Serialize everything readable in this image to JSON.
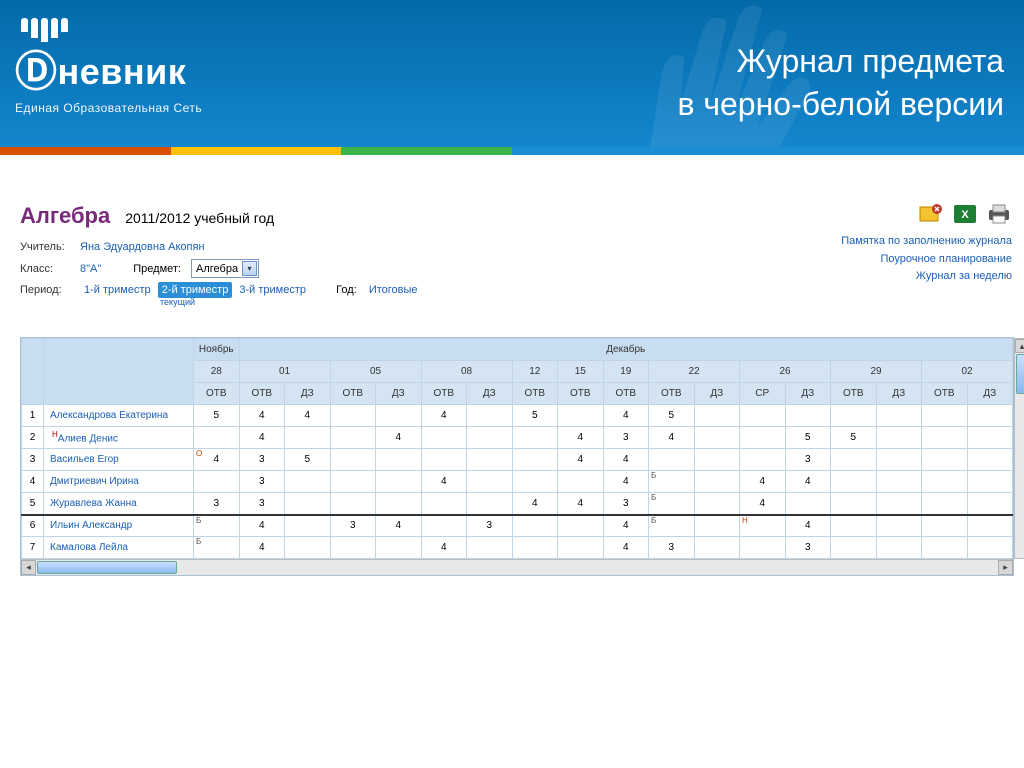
{
  "banner": {
    "logo_name": "невник",
    "logo_subtitle": "Единая Образовательная Сеть",
    "title_line1": "Журнал предмета",
    "title_line2": "в черно-белой версии"
  },
  "subject": {
    "title": "Алгебра",
    "year": "2011/2012 учебный год"
  },
  "meta": {
    "teacher_label": "Учитель:",
    "teacher_name": "Яна Эдуардовна Акопян",
    "class_label": "Класс:",
    "class_value": "8\"А\"",
    "subject_label": "Предмет:",
    "subject_select": "Алгебра",
    "period_label": "Период:",
    "year_label": "Год:",
    "final_label": "Итоговые",
    "current_label": "текущий"
  },
  "periods": [
    "1-й триместр",
    "2-й триместр",
    "3-й триместр"
  ],
  "active_period_index": 1,
  "links": {
    "memo": "Памятка по заполнению журнала",
    "planning": "Поурочное планирование",
    "week": "Журнал за неделю"
  },
  "months": {
    "nov": "Ноябрь",
    "dec": "Декабрь"
  },
  "days": [
    "28",
    "01",
    "05",
    "08",
    "12",
    "15",
    "19",
    "22",
    "26",
    "29",
    "02"
  ],
  "col_types": {
    "otv": "ОТВ",
    "dz": "ДЗ",
    "sr": "СР"
  },
  "columns_row3": [
    "ОТВ",
    "ОТВ",
    "ДЗ",
    "ОТВ",
    "ДЗ",
    "ОТВ",
    "ДЗ",
    "ОТВ",
    "ОТВ",
    "ОТВ",
    "ОТВ",
    "ДЗ",
    "СР",
    "ДЗ",
    "ОТВ",
    "ДЗ",
    "ОТВ",
    "ДЗ"
  ],
  "students": [
    {
      "num": "1",
      "name": "Александрова Екатерина",
      "badge": "",
      "cells": [
        "5",
        "4",
        "4",
        "",
        "",
        "4",
        "",
        "5",
        "",
        "4",
        "5",
        "",
        "",
        "",
        "",
        "",
        "",
        ""
      ]
    },
    {
      "num": "2",
      "name": "Алиев Денис",
      "badge": "Н",
      "cells": [
        "",
        "4",
        "",
        "",
        "4",
        "",
        "",
        "",
        "4",
        "3",
        "4",
        "",
        "",
        "5",
        "5",
        "",
        "",
        ""
      ]
    },
    {
      "num": "3",
      "name": "Васильев Егор",
      "badge": "",
      "cells": [
        "4",
        "3",
        "5",
        "",
        "",
        "",
        "",
        "",
        "4",
        "4",
        "",
        "",
        "",
        "3",
        "",
        "",
        "",
        ""
      ],
      "pre": "О"
    },
    {
      "num": "4",
      "name": "Дмитриевич Ирина",
      "badge": "",
      "cells": [
        "",
        "3",
        "",
        "",
        "",
        "4",
        "",
        "",
        "",
        "4",
        "",
        "",
        "4",
        "4",
        "",
        "",
        "",
        ""
      ],
      "badges": {
        "10": "Б"
      }
    },
    {
      "num": "5",
      "name": "Журавлева Жанна",
      "badge": "",
      "cells": [
        "3",
        "3",
        "",
        "",
        "",
        "",
        "",
        "4",
        "4",
        "3",
        "",
        "",
        "4",
        "",
        "",
        "",
        "",
        ""
      ],
      "badges": {
        "10": "Б"
      }
    },
    {
      "num": "6",
      "name": "Ильин Александр",
      "badge": "",
      "cells": [
        "",
        "4",
        "",
        "3",
        "4",
        "",
        "3",
        "",
        "",
        "4",
        "",
        "",
        "",
        "4",
        "",
        "",
        "",
        ""
      ],
      "pre": "Б",
      "badges": {
        "10": "Б",
        "12": "Н"
      }
    },
    {
      "num": "7",
      "name": "Камалова Лейла",
      "badge": "",
      "cells": [
        "",
        "4",
        "",
        "",
        "",
        "4",
        "",
        "",
        "",
        "4",
        "3",
        "",
        "",
        "3",
        "",
        "",
        "",
        ""
      ],
      "pre": "Б"
    }
  ]
}
